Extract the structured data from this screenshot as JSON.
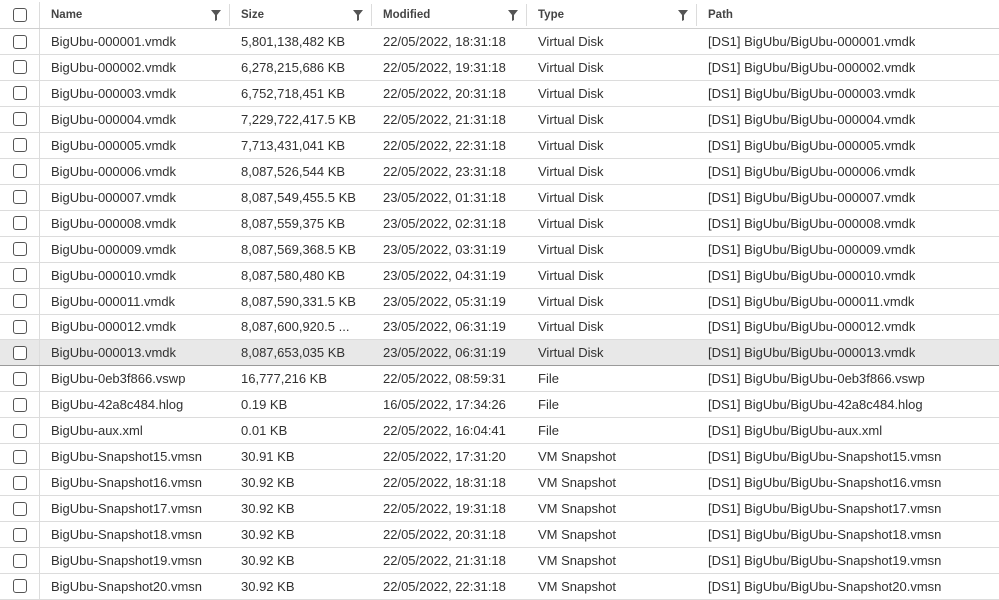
{
  "header": {
    "name": "Name",
    "size": "Size",
    "modified": "Modified",
    "type": "Type",
    "path": "Path"
  },
  "rows": [
    {
      "name": "BigUbu-000001.vmdk",
      "size": "5,801,138,482 KB",
      "modified": "22/05/2022, 18:31:18",
      "type": "Virtual Disk",
      "path": "[DS1] BigUbu/BigUbu-000001.vmdk"
    },
    {
      "name": "BigUbu-000002.vmdk",
      "size": "6,278,215,686 KB",
      "modified": "22/05/2022, 19:31:18",
      "type": "Virtual Disk",
      "path": "[DS1] BigUbu/BigUbu-000002.vmdk"
    },
    {
      "name": "BigUbu-000003.vmdk",
      "size": "6,752,718,451 KB",
      "modified": "22/05/2022, 20:31:18",
      "type": "Virtual Disk",
      "path": "[DS1] BigUbu/BigUbu-000003.vmdk"
    },
    {
      "name": "BigUbu-000004.vmdk",
      "size": "7,229,722,417.5 KB",
      "modified": "22/05/2022, 21:31:18",
      "type": "Virtual Disk",
      "path": "[DS1] BigUbu/BigUbu-000004.vmdk"
    },
    {
      "name": "BigUbu-000005.vmdk",
      "size": "7,713,431,041 KB",
      "modified": "22/05/2022, 22:31:18",
      "type": "Virtual Disk",
      "path": "[DS1] BigUbu/BigUbu-000005.vmdk"
    },
    {
      "name": "BigUbu-000006.vmdk",
      "size": "8,087,526,544 KB",
      "modified": "22/05/2022, 23:31:18",
      "type": "Virtual Disk",
      "path": "[DS1] BigUbu/BigUbu-000006.vmdk"
    },
    {
      "name": "BigUbu-000007.vmdk",
      "size": "8,087,549,455.5 KB",
      "modified": "23/05/2022, 01:31:18",
      "type": "Virtual Disk",
      "path": "[DS1] BigUbu/BigUbu-000007.vmdk"
    },
    {
      "name": "BigUbu-000008.vmdk",
      "size": "8,087,559,375 KB",
      "modified": "23/05/2022, 02:31:18",
      "type": "Virtual Disk",
      "path": "[DS1] BigUbu/BigUbu-000008.vmdk"
    },
    {
      "name": "BigUbu-000009.vmdk",
      "size": "8,087,569,368.5 KB",
      "modified": "23/05/2022, 03:31:19",
      "type": "Virtual Disk",
      "path": "[DS1] BigUbu/BigUbu-000009.vmdk"
    },
    {
      "name": "BigUbu-000010.vmdk",
      "size": "8,087,580,480 KB",
      "modified": "23/05/2022, 04:31:19",
      "type": "Virtual Disk",
      "path": "[DS1] BigUbu/BigUbu-000010.vmdk"
    },
    {
      "name": "BigUbu-000011.vmdk",
      "size": "8,087,590,331.5 KB",
      "modified": "23/05/2022, 05:31:19",
      "type": "Virtual Disk",
      "path": "[DS1] BigUbu/BigUbu-000011.vmdk"
    },
    {
      "name": "BigUbu-000012.vmdk",
      "size": "8,087,600,920.5 ...",
      "modified": "23/05/2022, 06:31:19",
      "type": "Virtual Disk",
      "path": "[DS1] BigUbu/BigUbu-000012.vmdk"
    },
    {
      "name": "BigUbu-000013.vmdk",
      "size": "8,087,653,035 KB",
      "modified": "23/05/2022, 06:31:19",
      "type": "Virtual Disk",
      "path": "[DS1] BigUbu/BigUbu-000013.vmdk",
      "selected": true
    },
    {
      "name": "BigUbu-0eb3f866.vswp",
      "size": "16,777,216 KB",
      "modified": "22/05/2022, 08:59:31",
      "type": "File",
      "path": "[DS1] BigUbu/BigUbu-0eb3f866.vswp"
    },
    {
      "name": "BigUbu-42a8c484.hlog",
      "size": "0.19 KB",
      "modified": "16/05/2022, 17:34:26",
      "type": "File",
      "path": "[DS1] BigUbu/BigUbu-42a8c484.hlog"
    },
    {
      "name": "BigUbu-aux.xml",
      "size": "0.01 KB",
      "modified": "22/05/2022, 16:04:41",
      "type": "File",
      "path": "[DS1] BigUbu/BigUbu-aux.xml"
    },
    {
      "name": "BigUbu-Snapshot15.vmsn",
      "size": "30.91 KB",
      "modified": "22/05/2022, 17:31:20",
      "type": "VM Snapshot",
      "path": "[DS1] BigUbu/BigUbu-Snapshot15.vmsn"
    },
    {
      "name": "BigUbu-Snapshot16.vmsn",
      "size": "30.92 KB",
      "modified": "22/05/2022, 18:31:18",
      "type": "VM Snapshot",
      "path": "[DS1] BigUbu/BigUbu-Snapshot16.vmsn"
    },
    {
      "name": "BigUbu-Snapshot17.vmsn",
      "size": "30.92 KB",
      "modified": "22/05/2022, 19:31:18",
      "type": "VM Snapshot",
      "path": "[DS1] BigUbu/BigUbu-Snapshot17.vmsn"
    },
    {
      "name": "BigUbu-Snapshot18.vmsn",
      "size": "30.92 KB",
      "modified": "22/05/2022, 20:31:18",
      "type": "VM Snapshot",
      "path": "[DS1] BigUbu/BigUbu-Snapshot18.vmsn"
    },
    {
      "name": "BigUbu-Snapshot19.vmsn",
      "size": "30.92 KB",
      "modified": "22/05/2022, 21:31:18",
      "type": "VM Snapshot",
      "path": "[DS1] BigUbu/BigUbu-Snapshot19.vmsn"
    },
    {
      "name": "BigUbu-Snapshot20.vmsn",
      "size": "30.92 KB",
      "modified": "22/05/2022, 22:31:18",
      "type": "VM Snapshot",
      "path": "[DS1] BigUbu/BigUbu-Snapshot20.vmsn"
    }
  ],
  "icons": {
    "filter": "filter-funnel-icon",
    "checkbox": "checkbox"
  }
}
